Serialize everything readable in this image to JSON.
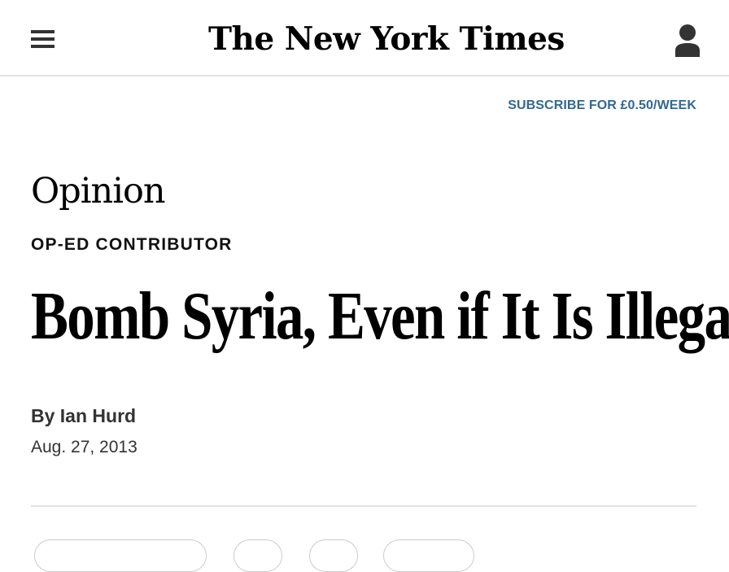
{
  "header": {
    "logo_text": "The New York Times",
    "menu_icon": "hamburger-menu-icon",
    "account_icon": "user-account-icon"
  },
  "subscribe": {
    "label": "SUBSCRIBE FOR £0.50/WEEK",
    "color": "#326891"
  },
  "article": {
    "section": "Opinion",
    "kicker": "OP-ED CONTRIBUTOR",
    "headline": "Bomb Syria, Even if It Is Illegal",
    "byline_prefix": "By",
    "author": "Ian Hurd",
    "date": "Aug. 27, 2013"
  }
}
